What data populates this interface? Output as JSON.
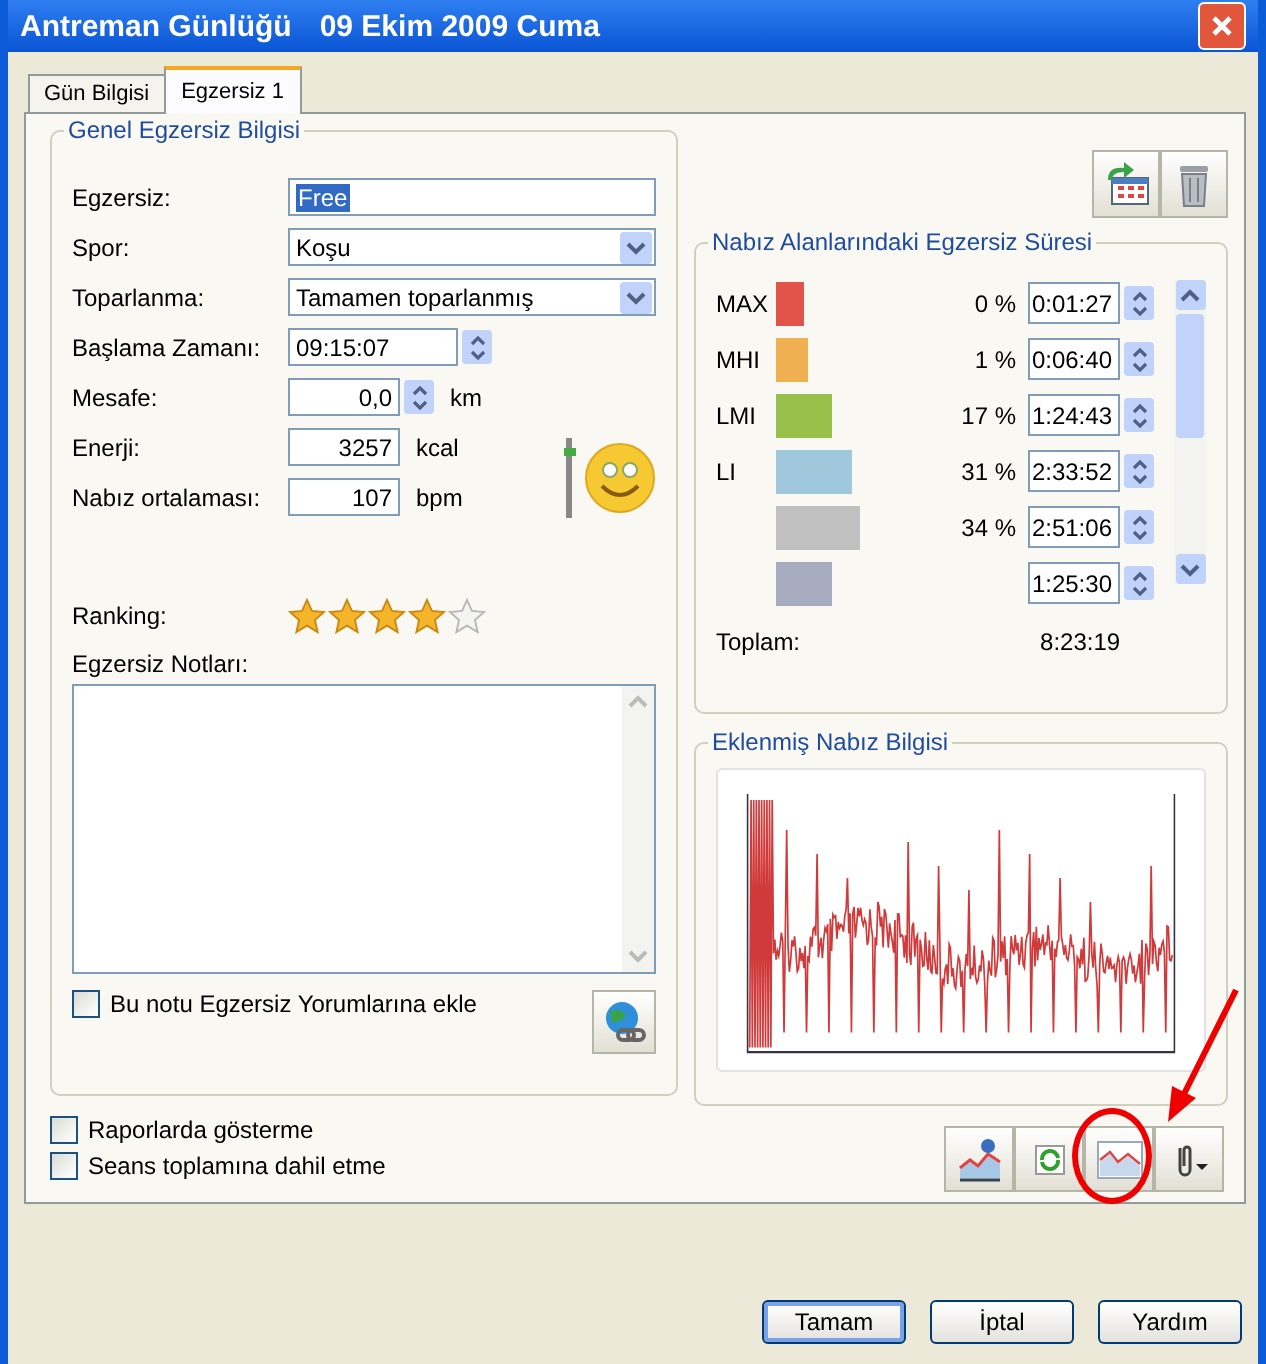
{
  "window": {
    "title": "Antreman Günlüğü",
    "date": "09 Ekim 2009 Cuma"
  },
  "tabs": [
    {
      "label": "Gün Bilgisi",
      "selected": false
    },
    {
      "label": "Egzersiz 1",
      "selected": true
    }
  ],
  "general": {
    "title": "Genel Egzersiz Bilgisi",
    "fields": [
      {
        "kind": "text",
        "label": "Egzersiz:",
        "value": "Free",
        "highlighted": true
      },
      {
        "kind": "combo",
        "label": "Spor:",
        "value": "Koşu",
        "highlighted": false
      },
      {
        "kind": "combo",
        "label": "Toparlanma:",
        "value": "Tamamen toparlanmış",
        "highlighted": false
      },
      {
        "kind": "spin",
        "label": "Başlama Zamanı:",
        "value": "09:15:07",
        "highlighted": false
      },
      {
        "kind": "spin",
        "label": "Mesafe:",
        "value": "0,0",
        "unit": "km",
        "highlighted": false
      },
      {
        "kind": "number",
        "label": "Enerji:",
        "value": "3257",
        "unit": "kcal",
        "highlighted": false
      },
      {
        "kind": "number",
        "label": "Nabız ortalaması:",
        "value": "107",
        "unit": "bpm",
        "highlighted": false
      }
    ],
    "feeling": {
      "level": 0.85
    },
    "ranking": {
      "label": "Ranking:",
      "stars": 4
    },
    "notes": {
      "label": "Egzersiz Notları:"
    },
    "note_checkbox": {
      "label": "Bu notu Egzersiz Yorumlarına ekle",
      "checked": false
    }
  },
  "options": [
    {
      "label": "Raporlarda gösterme",
      "checked": false
    },
    {
      "label": "Seans toplamına dahil etme",
      "checked": false
    }
  ],
  "zones": {
    "title": "Nabız Alanlarındaki Egzersiz Süresi",
    "rows": [
      {
        "label": "MAX",
        "color": "#e0544a",
        "percent": "0 %",
        "time": "0:01:27"
      },
      {
        "label": "MHI",
        "color": "#eeb050",
        "percent": "1 %",
        "time": "0:06:40"
      },
      {
        "label": "LMI",
        "color": "#98c04a",
        "percent": "17 %",
        "time": "1:24:43"
      },
      {
        "label": "LI",
        "color": "#a0c8dc",
        "percent": "31 %",
        "time": "2:33:52"
      },
      {
        "color": "#c0c0c0",
        "percent": "34 %",
        "time": "2:51:06"
      },
      {
        "color": "#a8acc0",
        "time": "1:25:30"
      }
    ],
    "total": {
      "label": "Toplam:",
      "value": "8:23:19"
    }
  },
  "heart_rate": {
    "title": "Eklenmiş Nabız Bilgisi"
  },
  "buttons": [
    {
      "label": "Tamam",
      "default": true
    },
    {
      "label": "İptal",
      "default": false
    },
    {
      "label": "Yardım",
      "default": false
    }
  ]
}
